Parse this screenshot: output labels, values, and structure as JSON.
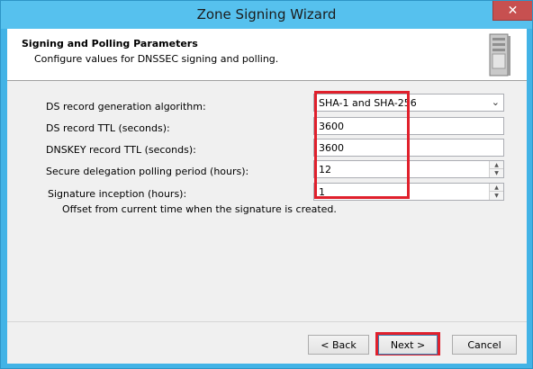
{
  "window": {
    "title": "Zone Signing Wizard",
    "close_glyph": "✕"
  },
  "header": {
    "title": "Signing and Polling Parameters",
    "subtitle": "Configure values for DNSSEC signing and polling."
  },
  "form": {
    "ds_algorithm": {
      "label": "DS record generation algorithm:",
      "value": "SHA-1 and SHA-256"
    },
    "ds_ttl": {
      "label": "DS record TTL (seconds):",
      "value": "3600"
    },
    "dnskey_ttl": {
      "label": "DNSKEY record TTL (seconds):",
      "value": "3600"
    },
    "polling_period": {
      "label": "Secure delegation polling period (hours):",
      "value": "12"
    },
    "signature_inception": {
      "label": "Signature inception (hours):",
      "value": "1"
    },
    "inception_help": "Offset from current time when the signature is created."
  },
  "buttons": {
    "back": "< Back",
    "next": "Next >",
    "cancel": "Cancel"
  },
  "icons": {
    "server": "server-icon",
    "dropdown": "chevron-down-icon",
    "spin_up": "spin-up-icon",
    "spin_down": "spin-down-icon"
  },
  "colors": {
    "title_bar": "#56c1ee",
    "highlight": "#e0202c"
  }
}
